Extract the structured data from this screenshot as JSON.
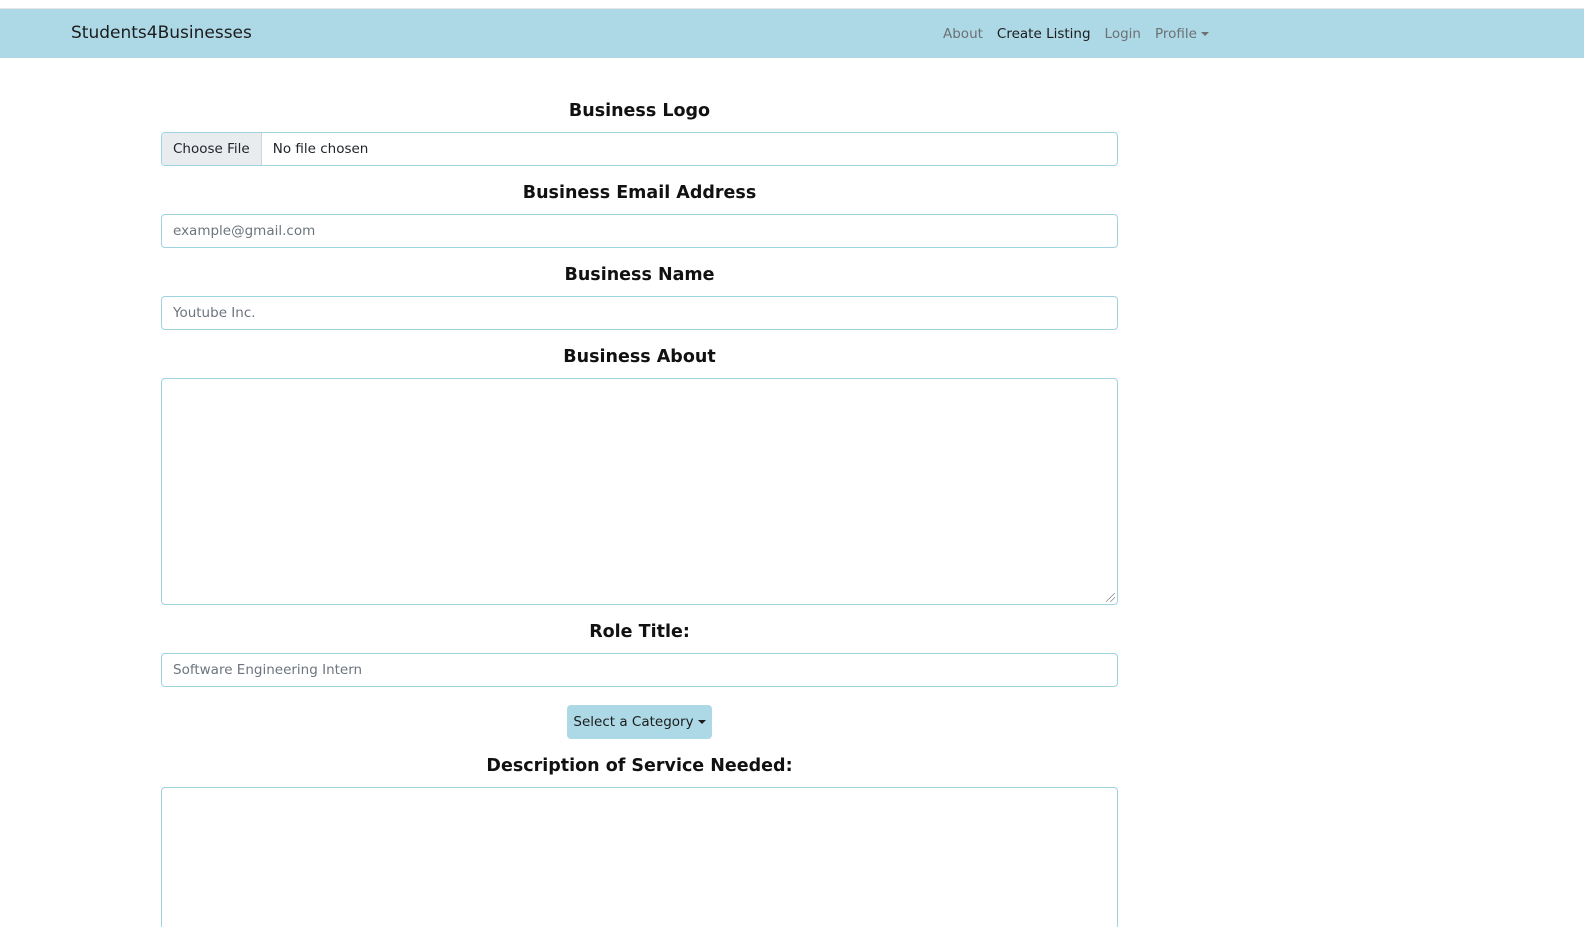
{
  "navbar": {
    "brand": "Students4Businesses",
    "links": [
      {
        "label": "About"
      },
      {
        "label": "Create Listing"
      },
      {
        "label": "Login"
      },
      {
        "label": "Profile"
      }
    ],
    "background": "#add8e6"
  },
  "form": {
    "logo": {
      "label": "Business Logo",
      "button_label": "Choose File",
      "file_status": "No file chosen"
    },
    "email": {
      "label": "Business Email Address",
      "placeholder": "example@gmail.com"
    },
    "name": {
      "label": "Business Name",
      "placeholder": "Youtube Inc."
    },
    "about": {
      "label": "Business About"
    },
    "role": {
      "label": "Role Title:",
      "placeholder": "Software Engineering Intern"
    },
    "category": {
      "button_label": "Select a Category"
    },
    "description": {
      "label": "Description of Service Needed:"
    }
  }
}
